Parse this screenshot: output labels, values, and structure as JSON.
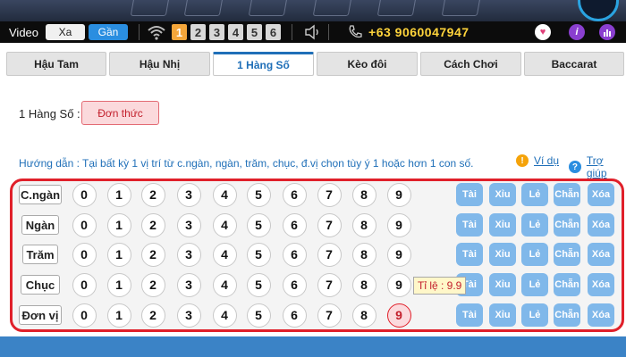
{
  "toolbar": {
    "video_label": "Video",
    "quality_options": [
      {
        "label": "Xa",
        "active": false
      },
      {
        "label": "Gần",
        "active": true
      }
    ],
    "signal_levels": [
      {
        "label": "1",
        "active": true
      },
      {
        "label": "2",
        "active": false
      },
      {
        "label": "3",
        "active": false
      },
      {
        "label": "4",
        "active": false
      },
      {
        "label": "5",
        "active": false
      },
      {
        "label": "6",
        "active": false
      }
    ],
    "hotline": "+63 9060047947",
    "colors": {
      "hotline": "#ffd43b",
      "active_segment": "#2a8ee0",
      "active_signal": "#f5a63a"
    },
    "right_icons": [
      "heart-add-icon",
      "info-icon",
      "stats-icon"
    ]
  },
  "tabs": [
    {
      "label": "Hậu Tam",
      "active": false
    },
    {
      "label": "Hậu Nhị",
      "active": false
    },
    {
      "label": "1 Hàng Số",
      "active": true
    },
    {
      "label": "Kèo đôi",
      "active": false
    },
    {
      "label": "Cách Chơi",
      "active": false
    },
    {
      "label": "Baccarat",
      "active": false
    }
  ],
  "mode": {
    "label": "1 Hàng Số :",
    "button": "Đơn thức"
  },
  "guide": {
    "text": "Hướng dẫn : Tại bất kỳ 1 vị trí từ c.ngàn, ngàn, trăm, chục, đ.vị chọn tùy ý 1 hoặc hơn 1 con số.",
    "example_link": "Ví dụ",
    "help_link": "Trợ giúp"
  },
  "board": {
    "digits": [
      "0",
      "1",
      "2",
      "3",
      "4",
      "5",
      "6",
      "7",
      "8",
      "9"
    ],
    "actions": [
      "Tài",
      "Xỉu",
      "Lẻ",
      "Chẵn",
      "Xóa"
    ],
    "rows": [
      {
        "label": "C.ngàn",
        "selected": []
      },
      {
        "label": "Ngàn",
        "selected": []
      },
      {
        "label": "Trăm",
        "selected": []
      },
      {
        "label": "Chục",
        "selected": []
      },
      {
        "label": "Đơn vị",
        "selected": [
          "9"
        ]
      }
    ],
    "tooltip": "Tỉ lệ : 9.9",
    "colors": {
      "border": "#e0202a",
      "action_button": "#80b8ea"
    }
  }
}
